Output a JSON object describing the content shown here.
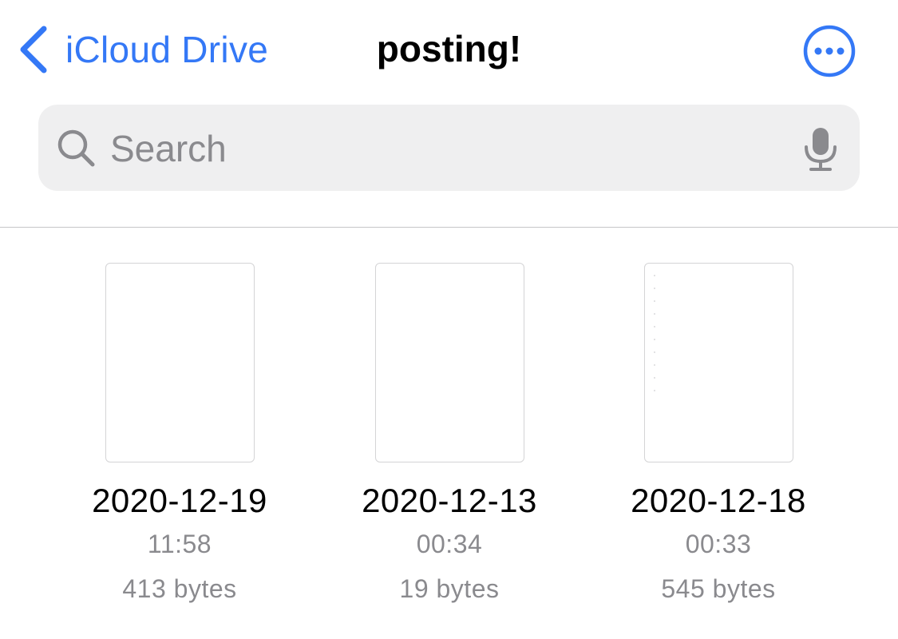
{
  "nav": {
    "back_label": "iCloud Drive",
    "title": "posting!",
    "more_icon": "ellipsis-circle-icon"
  },
  "search": {
    "placeholder": "Search",
    "value": "",
    "icons": [
      "search-icon",
      "microphone-icon"
    ]
  },
  "files": [
    {
      "name": "2020-12-19",
      "time": "11:58",
      "size": "413 bytes"
    },
    {
      "name": "2020-12-13",
      "time": "00:34",
      "size": "19 bytes"
    },
    {
      "name": "2020-12-18",
      "time": "00:33",
      "size": "545 bytes"
    }
  ],
  "colors": {
    "accent": "#3478f6",
    "secondary_text": "#8a8a8e",
    "search_bg": "#efeff0"
  }
}
